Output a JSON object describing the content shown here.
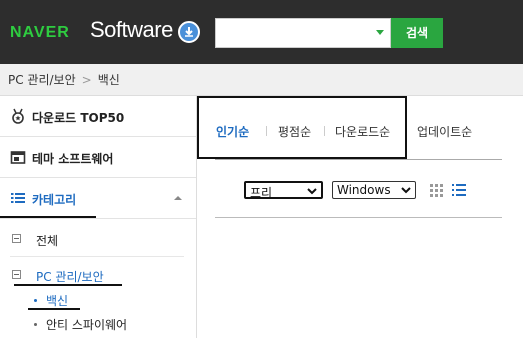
{
  "header": {
    "brand": "NAVER",
    "product": "Software",
    "search": {
      "value": "",
      "button_label": "검색"
    }
  },
  "breadcrumb": {
    "items": [
      "PC 관리/보안",
      "백신"
    ],
    "separator": ">"
  },
  "sidebar": {
    "top_items": [
      {
        "label": "다운로드 TOP50",
        "icon": "medal-icon"
      },
      {
        "label": "테마 소프트웨어",
        "icon": "window-icon"
      }
    ],
    "category": {
      "label": "카테고리",
      "icon": "list-icon"
    },
    "categories": [
      {
        "label": "전체"
      },
      {
        "label": "PC 관리/보안",
        "active": true
      }
    ],
    "subcategories": [
      {
        "label": "백신",
        "active": true
      },
      {
        "label": "안티 스파이웨어"
      }
    ]
  },
  "main": {
    "sort_tabs": [
      {
        "label": "인기순",
        "active": true
      },
      {
        "label": "평점순"
      },
      {
        "label": "다운로드순"
      },
      {
        "label": "업데이트순"
      }
    ],
    "filters": {
      "license": {
        "selected": "프리"
      },
      "os": {
        "selected": "Windows"
      }
    },
    "view_modes": [
      "grid-view-icon",
      "list-view-icon"
    ]
  },
  "colors": {
    "header_bg": "#2d2d2d",
    "brand_green": "#2ecc40",
    "search_btn": "#2aa640",
    "accent_blue": "#1e6bc0"
  }
}
